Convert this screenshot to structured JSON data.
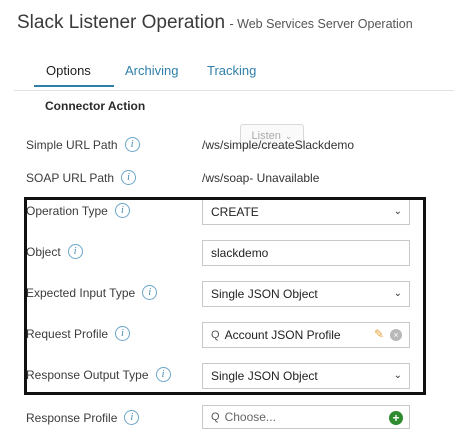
{
  "header": {
    "title": "Slack Listener Operation",
    "subtitle": "- Web Services Server Operation"
  },
  "tabs": [
    {
      "label": "Options",
      "active": true
    },
    {
      "label": "Archiving",
      "active": false
    },
    {
      "label": "Tracking",
      "active": false
    }
  ],
  "connector_action": {
    "label": "Connector Action",
    "value": "Listen"
  },
  "simple_url": {
    "label": "Simple URL Path",
    "value": "/ws/simple/createSlackdemo"
  },
  "soap_url": {
    "label": "SOAP URL Path",
    "value": "/ws/soap- Unavailable"
  },
  "operation_type": {
    "label": "Operation Type",
    "value": "CREATE"
  },
  "object": {
    "label": "Object",
    "value": "slackdemo"
  },
  "expected_input_type": {
    "label": "Expected Input Type",
    "value": "Single JSON Object"
  },
  "request_profile": {
    "label": "Request Profile",
    "value": "Account JSON Profile"
  },
  "response_output_type": {
    "label": "Response Output Type",
    "value": "Single JSON Object"
  },
  "response_profile": {
    "label": "Response Profile",
    "placeholder": "Choose..."
  },
  "icons": {
    "info": "i",
    "chevron": "⌄",
    "lookup": "Q",
    "edit": "✎",
    "clear": "×",
    "add": "+"
  },
  "colors": {
    "link": "#2f7fa8",
    "highlight_border": "#111111",
    "add_button": "#2e8b2e",
    "edit_icon": "#e6a23c"
  }
}
